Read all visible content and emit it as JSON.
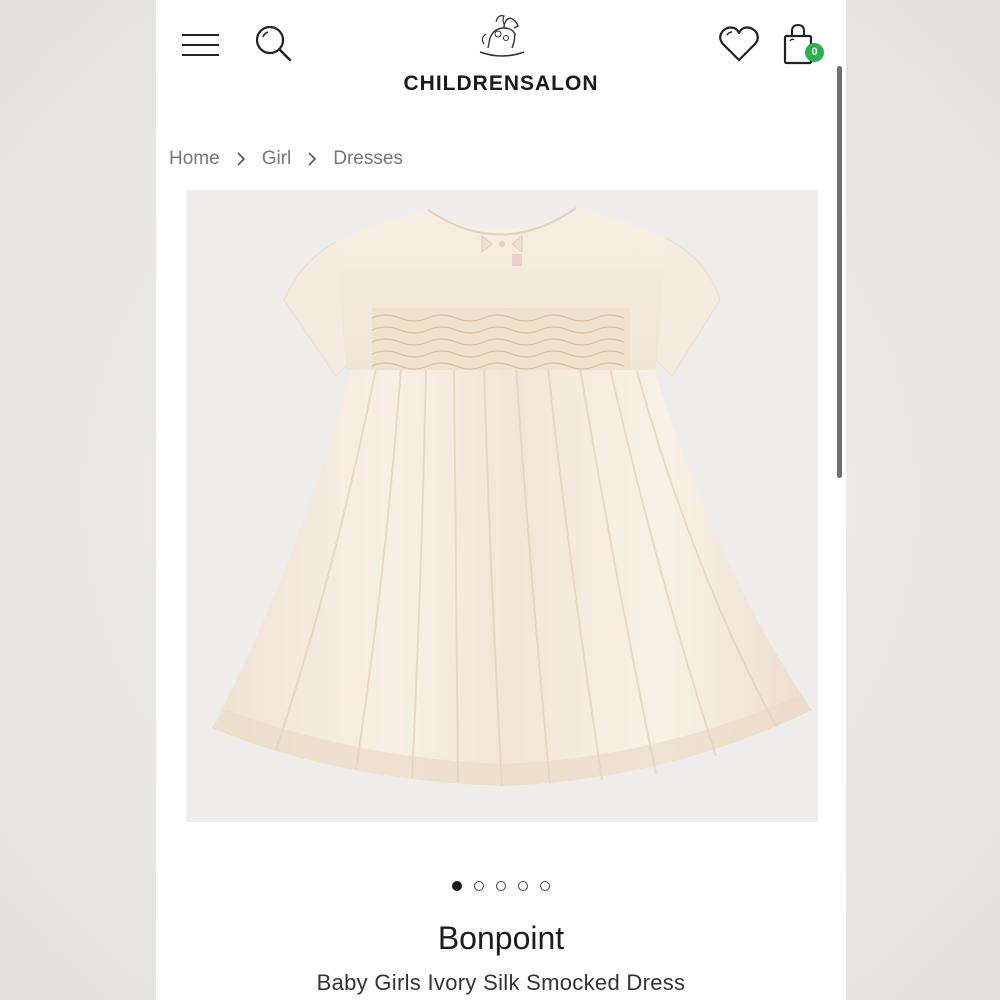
{
  "header": {
    "logo_text": "CHILDRENSALON",
    "bag_count": "0",
    "accent_color": "#2bb14b"
  },
  "breadcrumb": [
    "Home",
    "Girl",
    "Dresses"
  ],
  "gallery": {
    "image_count": 5,
    "active_index": 0
  },
  "product": {
    "brand": "Bonpoint",
    "name": "Baby Girls Ivory Silk Smocked Dress"
  },
  "icons": [
    "menu-icon",
    "search-icon",
    "logo-rocking-horse-icon",
    "heart-icon",
    "shopping-bag-icon",
    "chevron-right-icon"
  ]
}
